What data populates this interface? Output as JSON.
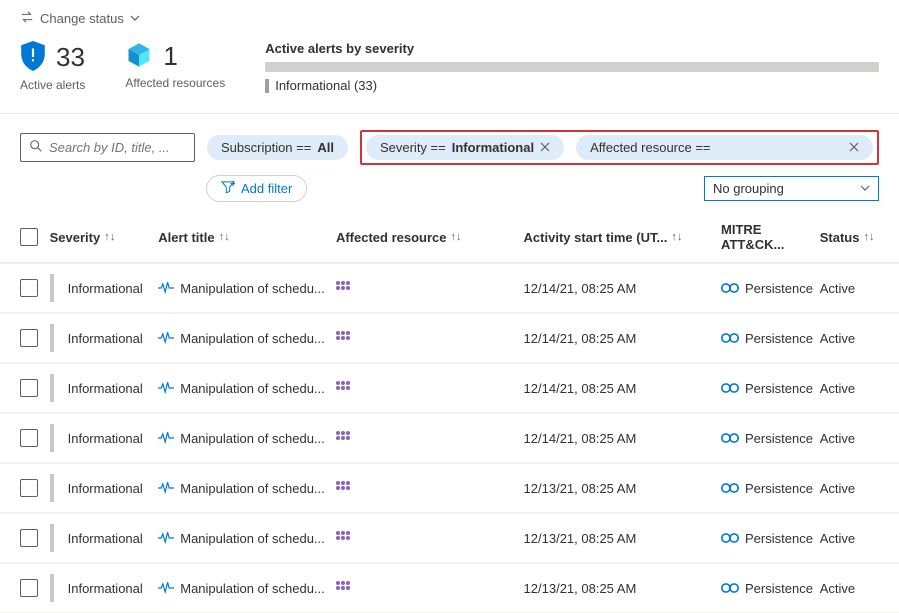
{
  "toolbar": {
    "change_status": "Change status"
  },
  "summary": {
    "active_alerts_count": "33",
    "active_alerts_label": "Active alerts",
    "affected_resources_count": "1",
    "affected_resources_label": "Affected resources",
    "severity_title": "Active alerts by severity",
    "severity_breakdown": "Informational (33)"
  },
  "search": {
    "placeholder": "Search by ID, title, ..."
  },
  "pills": {
    "subscription_key": "Subscription == ",
    "subscription_value": "All",
    "severity_key": "Severity == ",
    "severity_value": "Informational",
    "affected_resource": "Affected resource =="
  },
  "add_filter": "Add filter",
  "grouping": "No grouping",
  "columns": {
    "severity": "Severity",
    "title": "Alert title",
    "resource": "Affected resource",
    "time": "Activity start time (UT...",
    "mitre": "MITRE ATT&CK...",
    "status": "Status"
  },
  "rows": [
    {
      "severity": "Informational",
      "title": "Manipulation of schedu...",
      "time": "12/14/21, 08:25 AM",
      "mitre": "Persistence",
      "status": "Active"
    },
    {
      "severity": "Informational",
      "title": "Manipulation of schedu...",
      "time": "12/14/21, 08:25 AM",
      "mitre": "Persistence",
      "status": "Active"
    },
    {
      "severity": "Informational",
      "title": "Manipulation of schedu...",
      "time": "12/14/21, 08:25 AM",
      "mitre": "Persistence",
      "status": "Active"
    },
    {
      "severity": "Informational",
      "title": "Manipulation of schedu...",
      "time": "12/14/21, 08:25 AM",
      "mitre": "Persistence",
      "status": "Active"
    },
    {
      "severity": "Informational",
      "title": "Manipulation of schedu...",
      "time": "12/13/21, 08:25 AM",
      "mitre": "Persistence",
      "status": "Active"
    },
    {
      "severity": "Informational",
      "title": "Manipulation of schedu...",
      "time": "12/13/21, 08:25 AM",
      "mitre": "Persistence",
      "status": "Active"
    },
    {
      "severity": "Informational",
      "title": "Manipulation of schedu...",
      "time": "12/13/21, 08:25 AM",
      "mitre": "Persistence",
      "status": "Active"
    }
  ]
}
